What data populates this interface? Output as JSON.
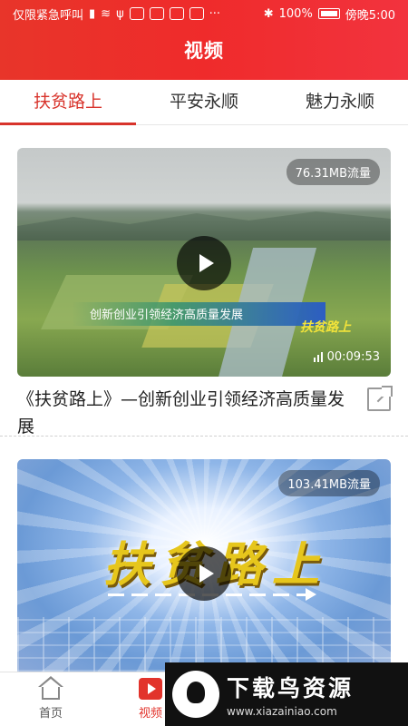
{
  "status_bar": {
    "left_text": "仅限紧急呼叫",
    "battery_text": "100%",
    "time_text": "傍晚5:00"
  },
  "header": {
    "title": "视频"
  },
  "tabs": [
    {
      "label": "扶贫路上",
      "active": true
    },
    {
      "label": "平安永顺",
      "active": false
    },
    {
      "label": "魅力永顺",
      "active": false
    }
  ],
  "feed": [
    {
      "size_badge": "76.31MB流量",
      "duration": "00:09:53",
      "video_caption": "创新创业引领经济高质量发展",
      "video_logo": "扶贫路上",
      "title": "《扶贫路上》—创新创业引领经济高质量发展"
    },
    {
      "size_badge": "103.41MB流量",
      "video_logo": "扶贫路上"
    }
  ],
  "bottom_nav": [
    {
      "label": "首页",
      "icon": "home-icon",
      "active": false
    },
    {
      "label": "视频",
      "icon": "video-icon",
      "active": true
    }
  ],
  "watermark": {
    "text": "下载鸟资源",
    "url": "www.xiazainiao.com"
  },
  "colors": {
    "brand_red": "#e8352a",
    "tab_active": "#d8332b"
  }
}
